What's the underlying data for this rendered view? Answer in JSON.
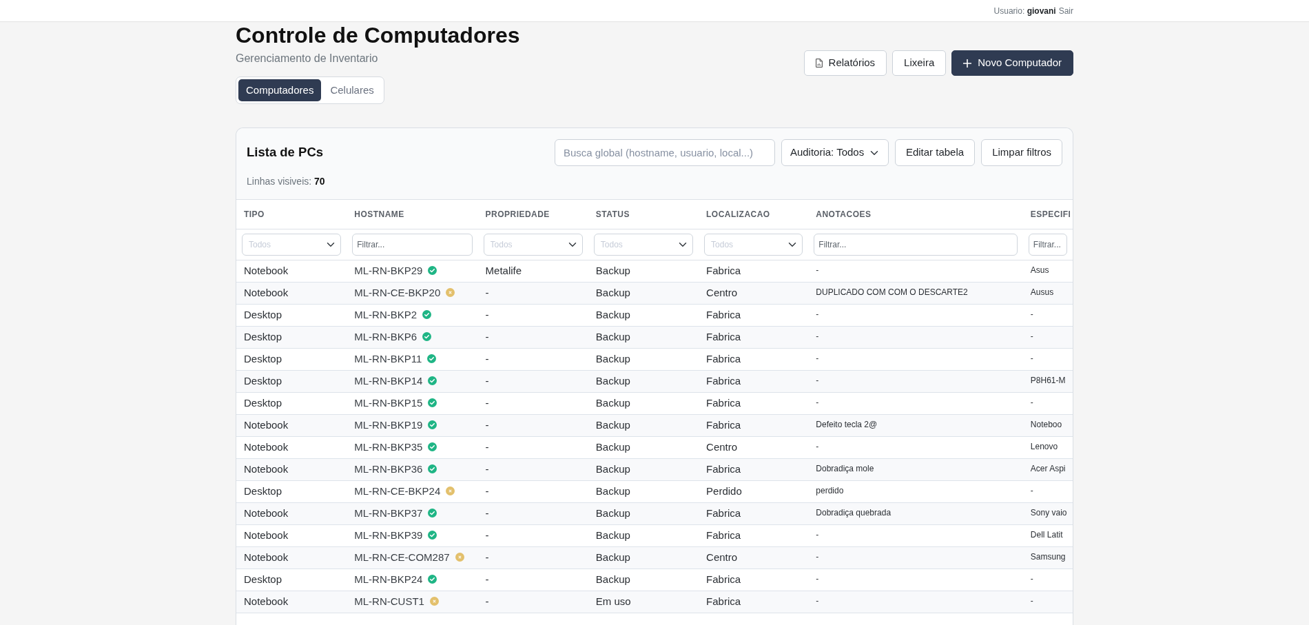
{
  "topbar": {
    "user_label": "Usuario: **giovani**",
    "logout": "Sair"
  },
  "header": {
    "title": "Controle de Computadores",
    "subtitle": "Gerenciamento de Inventario"
  },
  "tabs": [
    {
      "label": "Computadores",
      "selected": true
    },
    {
      "label": "Celulares",
      "selected": false
    }
  ],
  "actions": [
    {
      "label": "Relatórios",
      "kind": "report"
    },
    {
      "label": "Lixeira",
      "kind": "plain"
    },
    {
      "label": "Novo Computador",
      "kind": "primary"
    }
  ],
  "list": {
    "title": "Lista de PCs",
    "search": {
      "placeholder": "Busca global (hostname, usuario, local...)"
    },
    "audit_filter": "Auditoria: Todos",
    "buttons": [
      "Editar tabela",
      "Limpar filtros"
    ],
    "visible_rows": "Linhas visiveis: **70**"
  },
  "table": {
    "columns": [
      {
        "label": "TIPO",
        "kind": "plain",
        "filter": {
          "kind": "select",
          "value": "Todos"
        }
      },
      {
        "label": "HOSTNAME",
        "kind": "host",
        "filter": {
          "kind": "text",
          "placeholder": "Filtrar..."
        }
      },
      {
        "label": "PROPRIEDADE",
        "kind": "plain",
        "filter": {
          "kind": "select",
          "value": "Todos"
        }
      },
      {
        "label": "STATUS",
        "kind": "plain",
        "filter": {
          "kind": "select",
          "value": "Todos"
        }
      },
      {
        "label": "LOCALIZACAO",
        "kind": "plain",
        "filter": {
          "kind": "select",
          "value": "Todos"
        }
      },
      {
        "label": "ANOTACOES",
        "kind": "note",
        "filter": {
          "kind": "text",
          "placeholder": "Filtrar..."
        }
      },
      {
        "label": "ESPECIFI",
        "kind": "note",
        "filter": {
          "kind": "text",
          "placeholder": "Filtrar..."
        }
      }
    ],
    "rows": [
      {
        "cells": [
          "Notebook",
          "ML-RN-BKP29",
          "Metalife",
          "Backup",
          "Fabrica",
          "-",
          "Asus"
        ],
        "verified": true
      },
      {
        "cells": [
          "Notebook",
          "ML-RN-CE-BKP20",
          "-",
          "Backup",
          "Centro",
          "DUPLICADO COM COM O DESCARTE2",
          "Ausus"
        ],
        "verified": false
      },
      {
        "cells": [
          "Desktop",
          "ML-RN-BKP2",
          "-",
          "Backup",
          "Fabrica",
          "-",
          "-"
        ],
        "verified": true
      },
      {
        "cells": [
          "Desktop",
          "ML-RN-BKP6",
          "-",
          "Backup",
          "Fabrica",
          "-",
          "-"
        ],
        "verified": true
      },
      {
        "cells": [
          "Desktop",
          "ML-RN-BKP11",
          "-",
          "Backup",
          "Fabrica",
          "-",
          "-"
        ],
        "verified": true
      },
      {
        "cells": [
          "Desktop",
          "ML-RN-BKP14",
          "-",
          "Backup",
          "Fabrica",
          "-",
          "P8H61-M"
        ],
        "verified": true
      },
      {
        "cells": [
          "Desktop",
          "ML-RN-BKP15",
          "-",
          "Backup",
          "Fabrica",
          "-",
          "-"
        ],
        "verified": true
      },
      {
        "cells": [
          "Notebook",
          "ML-RN-BKP19",
          "-",
          "Backup",
          "Fabrica",
          "Defeito tecla 2@",
          "Noteboo"
        ],
        "verified": true
      },
      {
        "cells": [
          "Notebook",
          "ML-RN-BKP35",
          "-",
          "Backup",
          "Centro",
          "-",
          "Lenovo"
        ],
        "verified": true
      },
      {
        "cells": [
          "Notebook",
          "ML-RN-BKP36",
          "-",
          "Backup",
          "Fabrica",
          "Dobradiça mole",
          "Acer Aspi"
        ],
        "verified": true
      },
      {
        "cells": [
          "Desktop",
          "ML-RN-CE-BKP24",
          "-",
          "Backup",
          "Perdido",
          "perdido",
          "-"
        ],
        "verified": false
      },
      {
        "cells": [
          "Notebook",
          "ML-RN-BKP37",
          "-",
          "Backup",
          "Fabrica",
          "Dobradiça quebrada",
          "Sony vaio"
        ],
        "verified": true
      },
      {
        "cells": [
          "Notebook",
          "ML-RN-BKP39",
          "-",
          "Backup",
          "Fabrica",
          "-",
          "Dell Latit"
        ],
        "verified": true
      },
      {
        "cells": [
          "Notebook",
          "ML-RN-CE-COM287",
          "-",
          "Backup",
          "Centro",
          "-",
          "Samsung"
        ],
        "verified": false
      },
      {
        "cells": [
          "Desktop",
          "ML-RN-BKP24",
          "-",
          "Backup",
          "Fabrica",
          "-",
          "-"
        ],
        "verified": true
      },
      {
        "cells": [
          "Notebook",
          "ML-RN-CUST1",
          "-",
          "Em uso",
          "Fabrica",
          "-",
          "-"
        ],
        "verified": false
      }
    ]
  }
}
